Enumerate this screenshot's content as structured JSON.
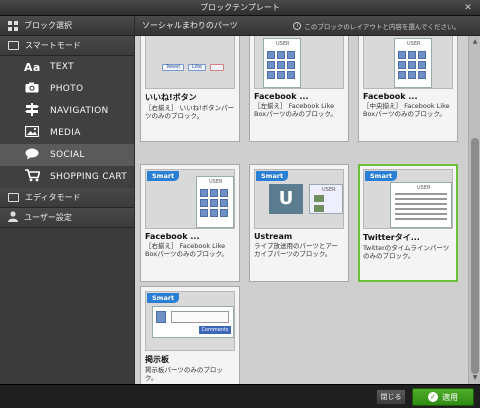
{
  "window": {
    "title": "ブロックテンプレート",
    "close_glyph": "✕"
  },
  "sidebar": {
    "header": "ブロック選択",
    "smart_mode": "スマートモード",
    "items": [
      {
        "label": "TEXT",
        "icon": "Aa"
      },
      {
        "label": "PHOTO",
        "icon": "camera-icon"
      },
      {
        "label": "NAVIGATION",
        "icon": "signpost-icon"
      },
      {
        "label": "MEDIA",
        "icon": "image-icon"
      },
      {
        "label": "SOCIAL",
        "icon": "speech-bubble-icon"
      },
      {
        "label": "SHOPPING CART",
        "icon": "cart-icon"
      }
    ],
    "editor_mode": "エディタモード",
    "user_settings": "ユーザー設定"
  },
  "main": {
    "header": "ソーシャルまわりのパーツ",
    "hint": "このブロックのレイアウトと内容を選んでください。",
    "cards": [
      {
        "title": "いいね!ボタン",
        "desc": "［右揃え］ いいね!ボタンパーツのみのブロック。",
        "badge": "",
        "thumb": "like",
        "tweet": "Tweet",
        "like": "Like"
      },
      {
        "title": "Facebook ...",
        "desc": "［左揃え］ Facebook Like Boxパーツのみのブロック。",
        "badge": "",
        "thumb": "fb",
        "user": "USER"
      },
      {
        "title": "Facebook ...",
        "desc": "［中央揃え］ Facebook Like Boxパーツのみのブロック。",
        "badge": "",
        "thumb": "fb",
        "user": "USER"
      },
      {
        "title": "Facebook ...",
        "desc": "［右揃え］ Facebook Like Boxパーツのみのブロック。",
        "badge": "Smart",
        "thumb": "fb",
        "user": "USER"
      },
      {
        "title": "Ustream",
        "desc": "ライブ放送用のパーツとアーカイブパーツのブロック。",
        "badge": "Smart",
        "thumb": "ust",
        "user": "USER",
        "ust": "U"
      },
      {
        "title": "Twitterタイ...",
        "desc": "Twitterのタイムラインパーツのみのブロック。",
        "badge": "Smart",
        "thumb": "tw",
        "user": "USER"
      },
      {
        "title": "掲示板",
        "desc": "掲示板パーツのみのブロック。",
        "badge": "Smart",
        "thumb": "board",
        "comment": "Comments"
      }
    ]
  },
  "footer": {
    "close_label": "閉じる",
    "apply_label": "適用"
  }
}
